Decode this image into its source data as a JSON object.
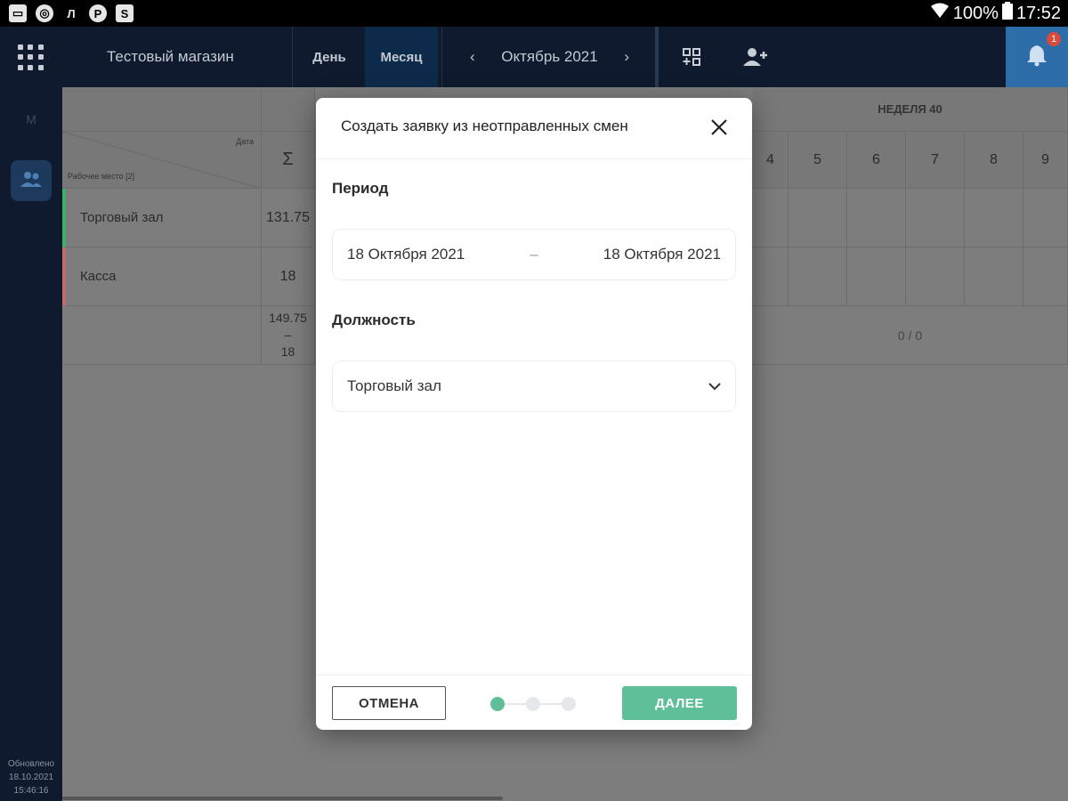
{
  "status_bar": {
    "battery": "100%",
    "time": "17:52"
  },
  "topbar": {
    "store_name": "Тестовый магазин",
    "tab_day": "День",
    "tab_month": "Месяц",
    "month_label": "Октябрь 2021",
    "notifications_count": "1"
  },
  "sidebar": {
    "label_m": "М",
    "updated_label": "Обновлено",
    "updated_date": "18.10.2021",
    "updated_time": "15:46:16"
  },
  "background": {
    "week_label": "НЕДЕЛЯ 40",
    "corner_date": "Дата",
    "corner_workplace": "Рабочее место [2]",
    "sum_symbol": "Σ",
    "days": [
      "4",
      "5",
      "6",
      "7",
      "8",
      "9"
    ],
    "rows": [
      {
        "name": "Торговый зал",
        "sum": "131.75",
        "accent": "#3bb36b"
      },
      {
        "name": "Касса",
        "sum": "18",
        "accent": "#c46b6b"
      }
    ],
    "total_top": "149.75",
    "total_dash": "–",
    "total_bottom": "18",
    "total_ratio": "0 / 0"
  },
  "modal": {
    "title": "Создать заявку из неотправленных смен",
    "period_label": "Период",
    "date_from": "18 Октября 2021",
    "date_sep": "–",
    "date_to": "18 Октября 2021",
    "position_label": "Должность",
    "position_value": "Торговый зал",
    "cancel_label": "ОТМЕНА",
    "next_label": "ДАЛЕЕ",
    "steps_total": 3,
    "step_current": 1,
    "accent_color": "#5fbf98"
  }
}
